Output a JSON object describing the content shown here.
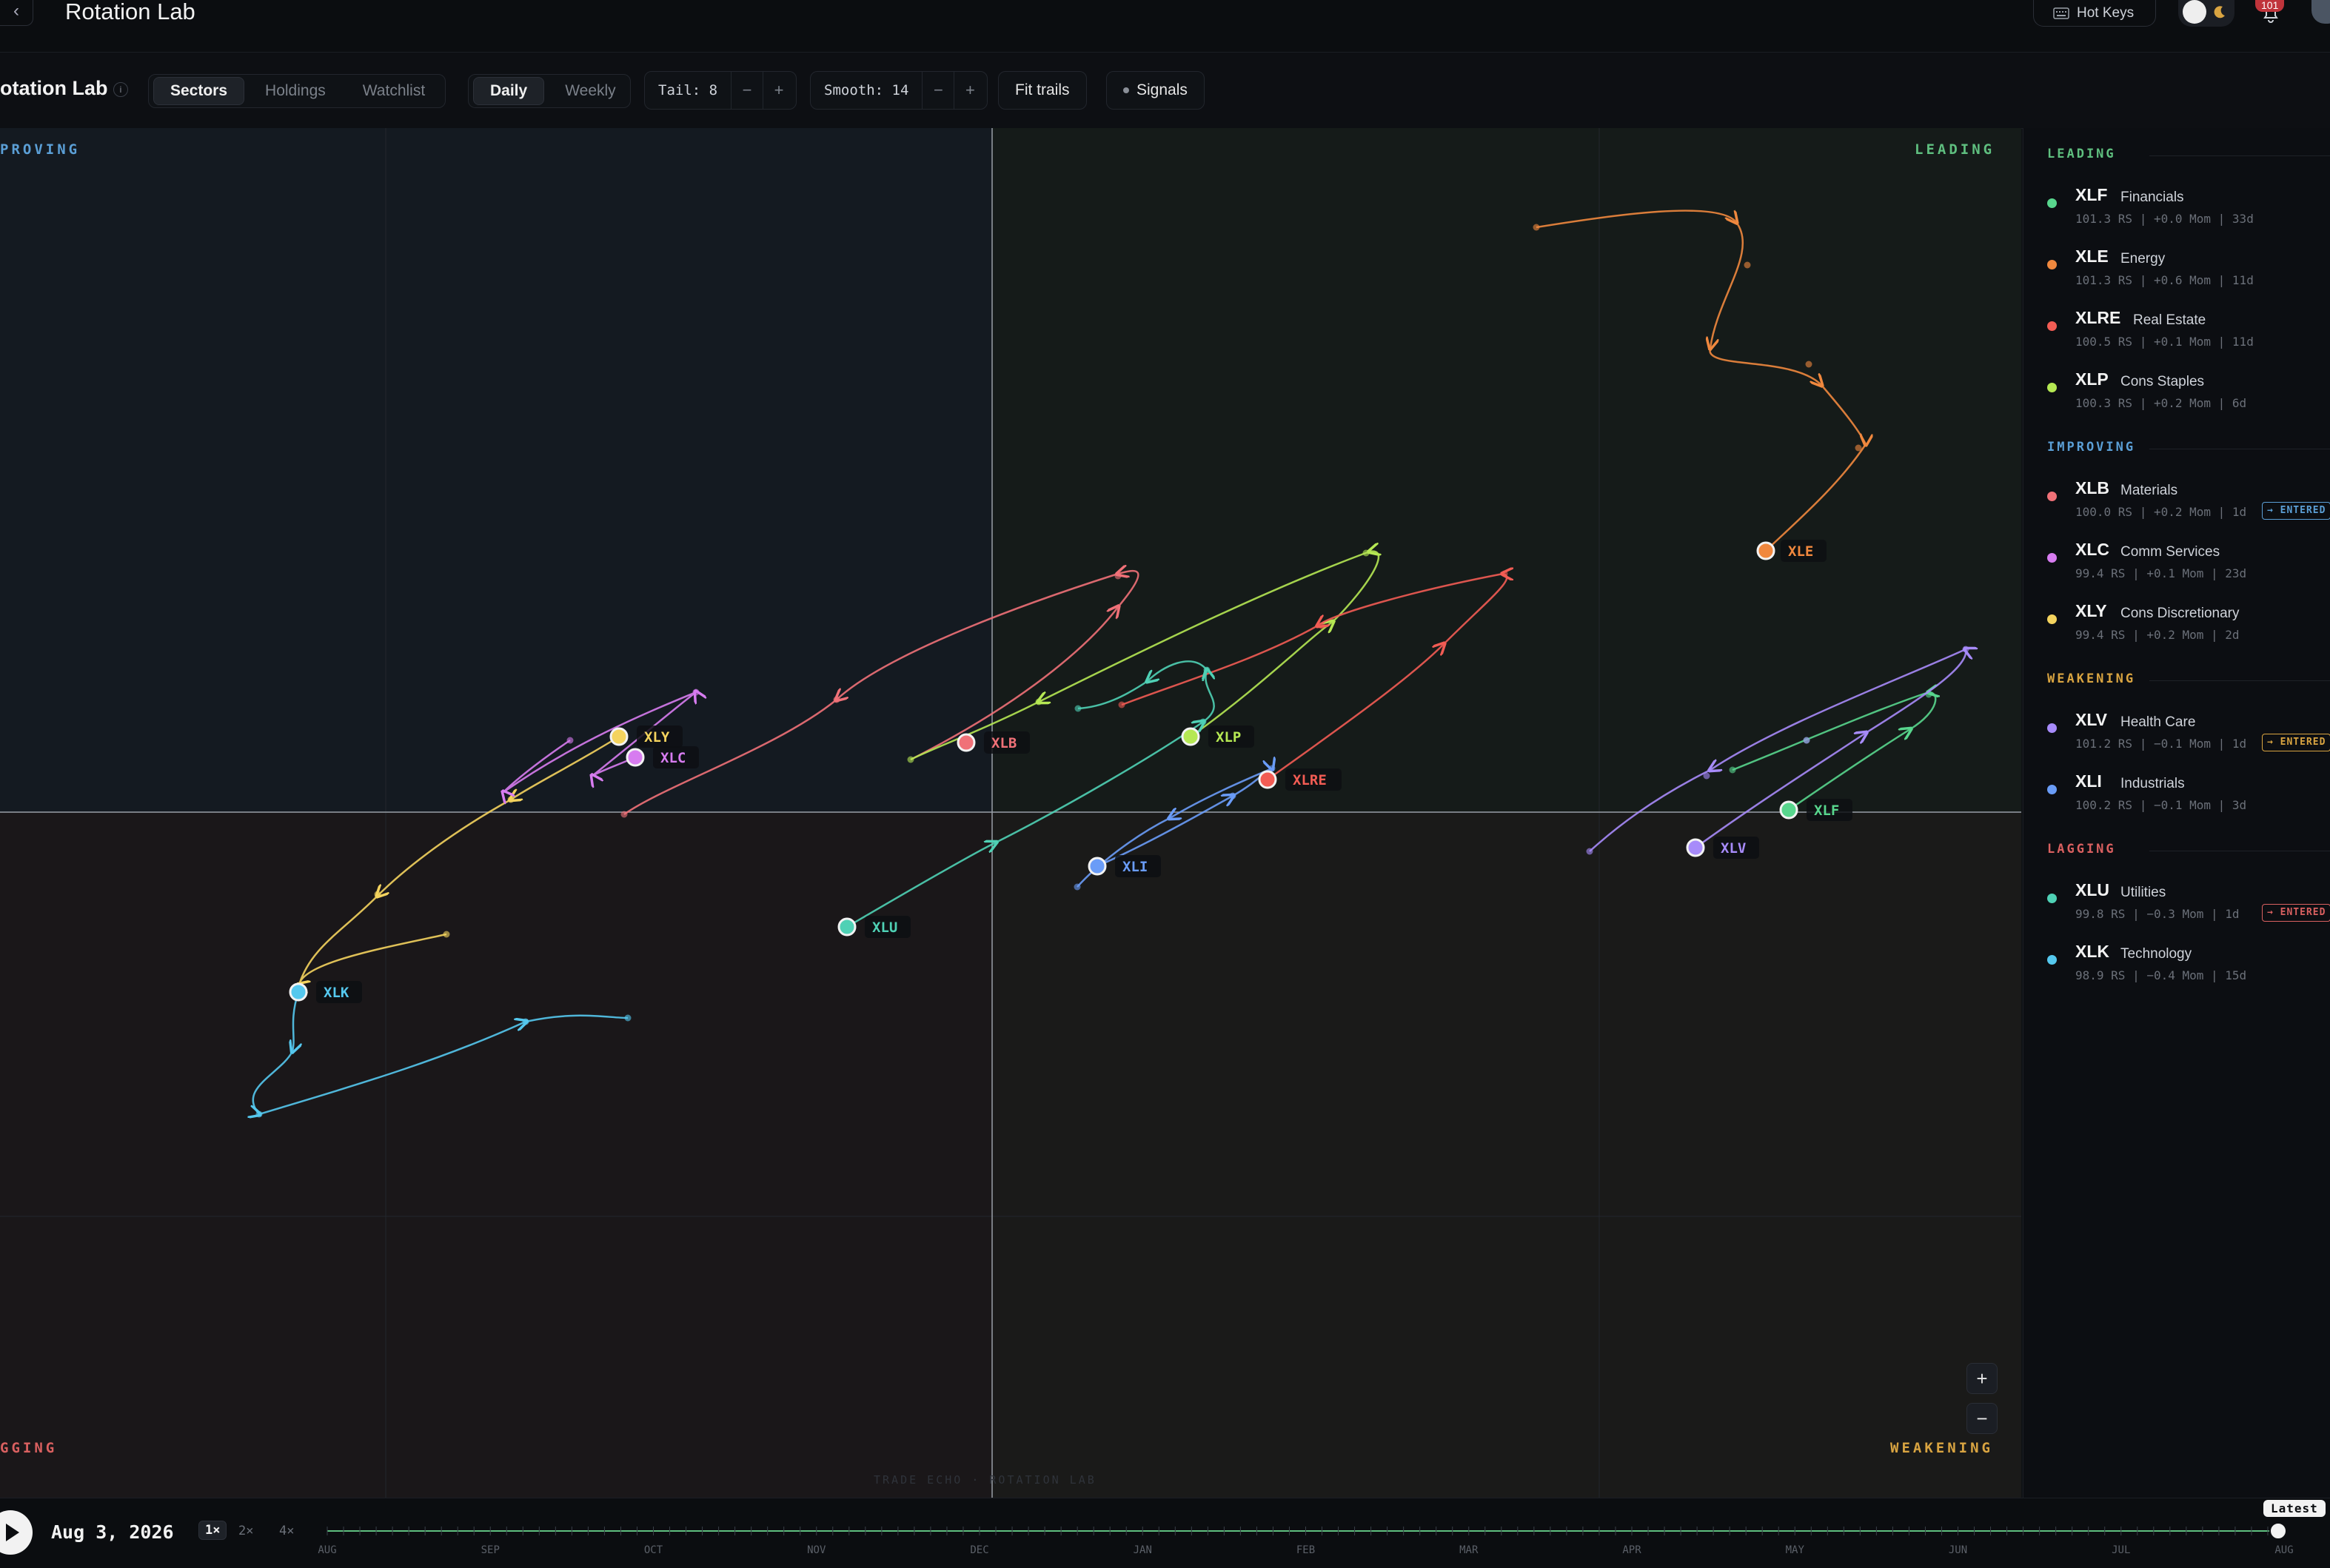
{
  "app": {
    "title": "Rotation Lab",
    "back_icon": "‹",
    "hotkeys_label": "Hot Keys",
    "notification_count": "101"
  },
  "toolbar": {
    "page_title": "otation Lab",
    "info_icon": "i",
    "views": [
      "Sectors",
      "Holdings",
      "Watchlist"
    ],
    "active_view": "Sectors",
    "intervals": [
      "Daily",
      "Weekly"
    ],
    "active_interval": "Daily",
    "tail_label": "Tail: 8",
    "smooth_label": "Smooth: 14",
    "minus": "−",
    "plus": "+",
    "fit_trails_label": "Fit trails",
    "signals_label": "Signals"
  },
  "quadrants": {
    "improving": "PROVING",
    "leading": "LEADING",
    "lagging": "GGING",
    "weakening": "WEAKENING",
    "colors": {
      "improving": "#5b9fd6",
      "leading": "#5fbf7f",
      "lagging": "#d96060",
      "weakening": "#d9a441"
    }
  },
  "chart": {
    "watermark": "TRADE ECHO · ROTATION LAB",
    "zoom_in": "+",
    "zoom_out": "−"
  },
  "chart_data": {
    "type": "scatter",
    "title": "",
    "tickers": [
      {
        "ticker": "XLE",
        "color": "#f0883e"
      },
      {
        "ticker": "XLB",
        "color": "#f07178"
      },
      {
        "ticker": "XLP",
        "color": "#b5e853"
      },
      {
        "ticker": "XLRE",
        "color": "#f25c54"
      },
      {
        "ticker": "XLY",
        "color": "#f4d35e"
      },
      {
        "ticker": "XLC",
        "color": "#d77cf0"
      },
      {
        "ticker": "XLU",
        "color": "#4fd1b5"
      },
      {
        "ticker": "XLI",
        "color": "#6a9cf7"
      },
      {
        "ticker": "XLK",
        "color": "#55c8ee"
      },
      {
        "ticker": "XLF",
        "color": "#58d68d"
      },
      {
        "ticker": "XLV",
        "color": "#a78bfa"
      }
    ]
  },
  "sidebar": {
    "groups": [
      {
        "name": "LEADING",
        "color": "#5fbf7f",
        "items": [
          {
            "ticker": "XLF",
            "name": "Financials",
            "stats": "101.3 RS | +0.0 Mom | 33d",
            "color": "#58d68d",
            "badge": ""
          },
          {
            "ticker": "XLE",
            "name": "Energy",
            "stats": "101.3 RS | +0.6 Mom | 11d",
            "color": "#f0883e",
            "badge": ""
          },
          {
            "ticker": "XLRE",
            "name": "Real Estate",
            "stats": "100.5 RS | +0.1 Mom | 11d",
            "color": "#f25c54",
            "badge": ""
          },
          {
            "ticker": "XLP",
            "name": "Cons Staples",
            "stats": "100.3 RS | +0.2 Mom | 6d",
            "color": "#b5e853",
            "badge": ""
          }
        ]
      },
      {
        "name": "IMPROVING",
        "color": "#5b9fd6",
        "items": [
          {
            "ticker": "XLB",
            "name": "Materials",
            "stats": "100.0 RS | +0.2 Mom | 1d",
            "color": "#f07178",
            "badge": "→ ENTERED"
          },
          {
            "ticker": "XLC",
            "name": "Comm Services",
            "stats": "99.4 RS | +0.1 Mom | 23d",
            "color": "#d77cf0",
            "badge": ""
          },
          {
            "ticker": "XLY",
            "name": "Cons Discretionary",
            "stats": "99.4 RS | +0.2 Mom | 2d",
            "color": "#f4d35e",
            "badge": ""
          }
        ]
      },
      {
        "name": "WEAKENING",
        "color": "#d9a441",
        "items": [
          {
            "ticker": "XLV",
            "name": "Health Care",
            "stats": "101.2 RS | −0.1 Mom | 1d",
            "color": "#a78bfa",
            "badge": "→ ENTERED"
          },
          {
            "ticker": "XLI",
            "name": "Industrials",
            "stats": "100.2 RS | −0.1 Mom | 3d",
            "color": "#6a9cf7",
            "badge": ""
          }
        ]
      },
      {
        "name": "LAGGING",
        "color": "#d96060",
        "items": [
          {
            "ticker": "XLU",
            "name": "Utilities",
            "stats": "99.8 RS | −0.3 Mom | 1d",
            "color": "#4fd1b5",
            "badge": "→ ENTERED"
          },
          {
            "ticker": "XLK",
            "name": "Technology",
            "stats": "98.9 RS | −0.4 Mom | 15d",
            "color": "#55c8ee",
            "badge": ""
          }
        ]
      }
    ]
  },
  "timeline": {
    "date": "Aug 3, 2026",
    "speeds": [
      "1×",
      "2×",
      "4×"
    ],
    "active_speed": "1×",
    "months": [
      "AUG",
      "SEP",
      "OCT",
      "NOV",
      "DEC",
      "JAN",
      "FEB",
      "MAR",
      "APR",
      "MAY",
      "JUN",
      "JUL",
      "AUG"
    ],
    "latest_label": "Latest",
    "position": 1.0
  }
}
